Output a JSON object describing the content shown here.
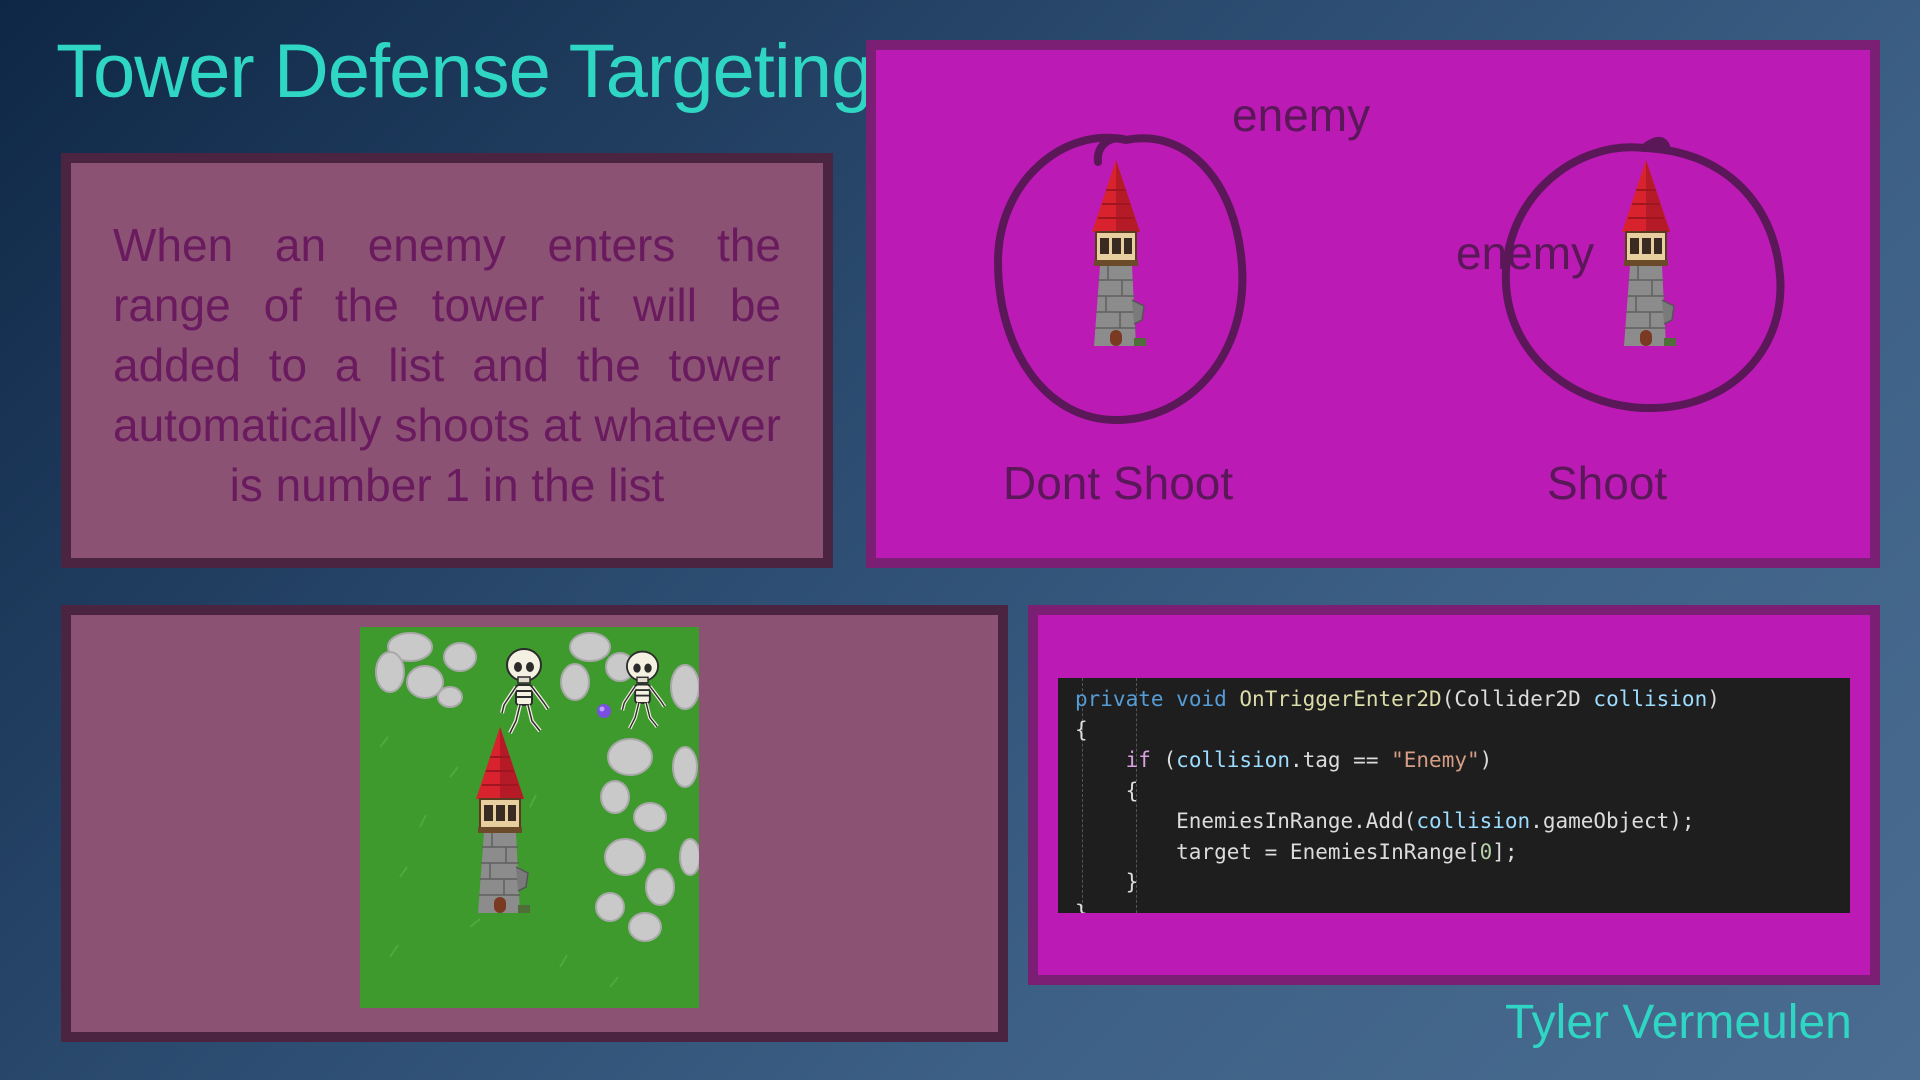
{
  "slide": {
    "title": "Tower Defense Targeting",
    "author": "Tyler Vermeulen"
  },
  "description": {
    "text": "When an enemy enters the range of the tower it will be added to a list and the tower automatically shoots at whatever is number 1 in the list"
  },
  "diagram": {
    "left": {
      "enemy_label": "enemy",
      "caption": "Dont Shoot"
    },
    "right": {
      "enemy_label": "enemy",
      "caption": "Shoot"
    }
  },
  "code": {
    "lines": [
      [
        {
          "t": "private",
          "c": "kw"
        },
        {
          "t": " ",
          "c": "ty"
        },
        {
          "t": "void",
          "c": "kw"
        },
        {
          "t": " ",
          "c": "ty"
        },
        {
          "t": "OnTriggerEnter2D",
          "c": "fn"
        },
        {
          "t": "(Collider2D ",
          "c": "ty"
        },
        {
          "t": "collision",
          "c": "pm"
        },
        {
          "t": ")",
          "c": "ty"
        }
      ],
      [
        {
          "t": "{",
          "c": "ty"
        }
      ],
      [
        {
          "t": "    ",
          "c": "ty"
        },
        {
          "t": "if",
          "c": "kw2"
        },
        {
          "t": " (",
          "c": "ty"
        },
        {
          "t": "collision",
          "c": "pm"
        },
        {
          "t": ".tag == ",
          "c": "ty"
        },
        {
          "t": "\"Enemy\"",
          "c": "st"
        },
        {
          "t": ")",
          "c": "ty"
        }
      ],
      [
        {
          "t": "    {",
          "c": "ty"
        }
      ],
      [
        {
          "t": "        EnemiesInRange.Add(",
          "c": "ty"
        },
        {
          "t": "collision",
          "c": "pm"
        },
        {
          "t": ".gameObject);",
          "c": "ty"
        }
      ],
      [
        {
          "t": "        target = EnemiesInRange[",
          "c": "ty"
        },
        {
          "t": "0",
          "c": "nm"
        },
        {
          "t": "];",
          "c": "ty"
        }
      ],
      [
        {
          "t": "    }",
          "c": "ty"
        }
      ],
      [
        {
          "t": "}",
          "c": "ty"
        }
      ]
    ]
  },
  "colors": {
    "title": "#2fd6c4",
    "panel_mauve": "#8b5273",
    "panel_magenta": "#bb1ab4",
    "tower_roof": "#d8222e",
    "grass": "#3f9a2e"
  },
  "icons": {
    "tower": "tower-sprite",
    "enemy": "skeleton-sprite",
    "projectile": "orb-sprite"
  }
}
